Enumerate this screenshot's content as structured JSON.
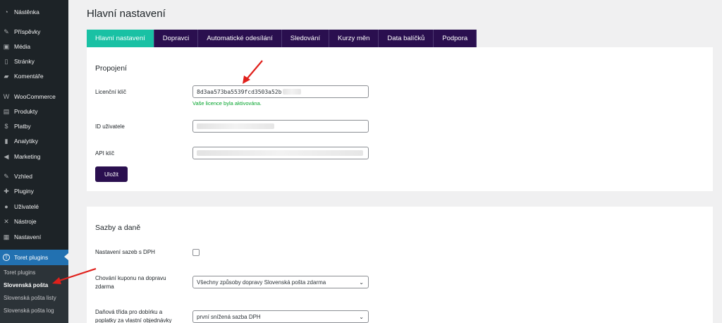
{
  "sidebar": {
    "items": [
      {
        "label": "Nástěnka",
        "icon": "dashboard-icon",
        "glyph": "◔"
      },
      {
        "label": "Příspěvky",
        "icon": "pin-icon",
        "glyph": "✎"
      },
      {
        "label": "Média",
        "icon": "media-icon",
        "glyph": "▣"
      },
      {
        "label": "Stránky",
        "icon": "page-icon",
        "glyph": "▯"
      },
      {
        "label": "Komentáře",
        "icon": "comment-icon",
        "glyph": "▰"
      },
      {
        "label": "WooCommerce",
        "icon": "woocommerce-icon",
        "glyph": "W"
      },
      {
        "label": "Produkty",
        "icon": "products-icon",
        "glyph": "▤"
      },
      {
        "label": "Platby",
        "icon": "payments-icon",
        "glyph": "$"
      },
      {
        "label": "Analytiky",
        "icon": "analytics-icon",
        "glyph": "▮"
      },
      {
        "label": "Marketing",
        "icon": "megaphone-icon",
        "glyph": "◀"
      },
      {
        "label": "Vzhled",
        "icon": "brush-icon",
        "glyph": "✎"
      },
      {
        "label": "Pluginy",
        "icon": "plugin-icon",
        "glyph": "✚"
      },
      {
        "label": "Uživatelé",
        "icon": "user-icon",
        "glyph": "●"
      },
      {
        "label": "Nástroje",
        "icon": "wrench-icon",
        "glyph": "✕"
      },
      {
        "label": "Nastavení",
        "icon": "settings-icon",
        "glyph": "▦"
      },
      {
        "label": "Toret plugins",
        "icon": "toret-icon",
        "glyph": "T"
      }
    ],
    "submenu": [
      "Toret plugins",
      "Slovenská pošta",
      "Slovenská pošta listy",
      "Slovenská pošta log"
    ]
  },
  "page": {
    "title": "Hlavní nastavení"
  },
  "tabs": [
    "Hlavní nastavení",
    "Dopravci",
    "Automatické odesílání",
    "Sledování",
    "Kurzy měn",
    "Data balíčků",
    "Podpora"
  ],
  "connection": {
    "title": "Propojení",
    "license_label": "Licenční klíč",
    "license_value": "8d3aa573ba5539fcd3503a52b",
    "license_note": "Vaše licence byla aktivována.",
    "user_id_label": "ID uživatele",
    "api_key_label": "API klíč",
    "save_label": "Uložit"
  },
  "rates": {
    "title": "Sazby a daně",
    "vat_label": "Nastavení sazeb s DPH",
    "coupon_label": "Chování kuponu na dopravu zdarma",
    "coupon_value": "Všechny způsoby dopravy Slovenská pošta zdarma",
    "tax_label": "Daňová třída pro dobírku a poplatky za vlastní objednávky",
    "tax_value": "první snížená sazba DPH"
  },
  "colors": {
    "accent": "#19c1a4",
    "tab_bg": "#2a0f4f",
    "annotation": "#e0201b"
  }
}
